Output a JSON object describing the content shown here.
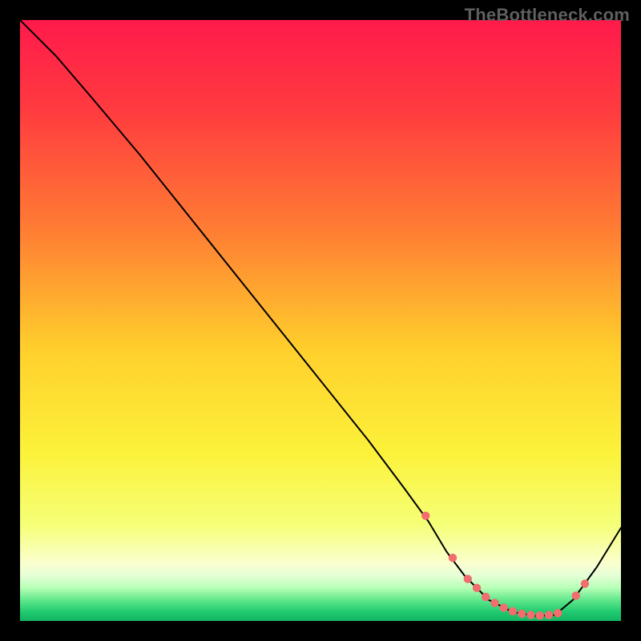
{
  "watermark": "TheBottleneck.com",
  "chart_data": {
    "type": "line",
    "title": "",
    "xlabel": "",
    "ylabel": "",
    "xlim": [
      0,
      100
    ],
    "ylim": [
      0,
      100
    ],
    "grid": false,
    "legend": false,
    "gradient_stops": [
      {
        "offset": 0.0,
        "color": "#ff1a4b"
      },
      {
        "offset": 0.15,
        "color": "#ff3b3f"
      },
      {
        "offset": 0.35,
        "color": "#ff7d33"
      },
      {
        "offset": 0.55,
        "color": "#ffd02c"
      },
      {
        "offset": 0.72,
        "color": "#fcf23a"
      },
      {
        "offset": 0.84,
        "color": "#f5ff77"
      },
      {
        "offset": 0.905,
        "color": "#faffd0"
      },
      {
        "offset": 0.925,
        "color": "#e4ffd6"
      },
      {
        "offset": 0.945,
        "color": "#b6ffb6"
      },
      {
        "offset": 0.965,
        "color": "#62e78c"
      },
      {
        "offset": 0.985,
        "color": "#1fc96f"
      },
      {
        "offset": 1.0,
        "color": "#14b562"
      }
    ],
    "series": [
      {
        "name": "bottleneck-curve",
        "type": "line",
        "color": "#000000",
        "x": [
          0,
          6,
          12,
          20,
          30,
          40,
          50,
          58,
          64,
          68,
          71,
          74,
          78,
          82,
          86,
          89,
          92,
          96,
          100
        ],
        "y": [
          100,
          94,
          87,
          77.5,
          65,
          52.5,
          40,
          30,
          22,
          16.5,
          11.5,
          7.5,
          3.5,
          1.5,
          0.8,
          1.0,
          3.5,
          9.0,
          15.5
        ]
      },
      {
        "name": "curve-markers",
        "type": "scatter",
        "color": "#f26d6d",
        "x": [
          67.5,
          72.0,
          74.5,
          76.0,
          77.5,
          79.0,
          80.5,
          82.0,
          83.5,
          85.0,
          86.5,
          88.0,
          89.5,
          92.5,
          94.0
        ],
        "y": [
          17.5,
          10.5,
          7.0,
          5.5,
          4.0,
          3.0,
          2.2,
          1.6,
          1.2,
          1.0,
          0.9,
          1.0,
          1.3,
          4.2,
          6.2
        ]
      }
    ]
  }
}
